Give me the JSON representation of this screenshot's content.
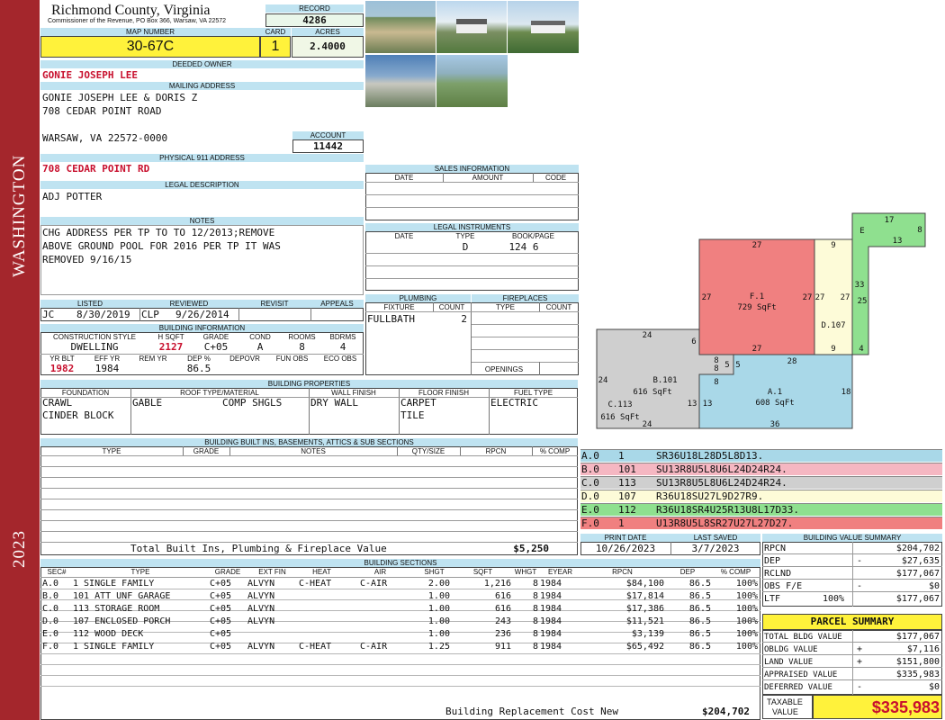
{
  "sidebar": {
    "district": "WASHINGTON",
    "year": "2023"
  },
  "header": {
    "county": "Richmond County, Virginia",
    "address": "Commissioner of the Revenue, PO Box 366, Warsaw, VA 22572"
  },
  "record": {
    "label": "RECORD",
    "value": "4286"
  },
  "map": {
    "label": "MAP NUMBER",
    "value": "30-67C"
  },
  "card": {
    "label": "CARD",
    "value": "1"
  },
  "acres": {
    "label": "ACRES",
    "value": "2.4000"
  },
  "deeded_owner": {
    "label": "DEEDED OWNER",
    "value": "GONIE JOSEPH LEE"
  },
  "mailing": {
    "label": "MAILING ADDRESS",
    "line1": "GONIE JOSEPH LEE & DORIS Z",
    "line2": "708 CEDAR POINT ROAD",
    "line3": "WARSAW, VA 22572-0000"
  },
  "account": {
    "label": "ACCOUNT",
    "value": "11442"
  },
  "physical": {
    "label": "PHYSICAL 911 ADDRESS",
    "value": "708 CEDAR POINT RD"
  },
  "legal": {
    "label": "LEGAL DESCRIPTION",
    "value": "ADJ POTTER"
  },
  "notes": {
    "label": "NOTES",
    "line1": "CHG ADDRESS PER TP TO TO 12/2013;REMOVE",
    "line2": "ABOVE GROUND POOL FOR 2016 PER TP IT WAS",
    "line3": "REMOVED 9/16/15"
  },
  "review": {
    "listed_label": "LISTED",
    "reviewed_label": "REVIEWED",
    "revisit_label": "REVISIT",
    "appeals_label": "APPEALS",
    "listed_by": "JC",
    "listed_date": "8/30/2019",
    "reviewed_by": "CLP",
    "reviewed_date": "9/26/2014"
  },
  "building_info": {
    "label": "BUILDING INFORMATION",
    "h_style": "CONSTRUCTION STYLE",
    "h_sqft": "H SQFT",
    "h_grade": "GRADE",
    "h_cond": "COND",
    "h_rooms": "ROOMS",
    "h_bdrms": "BDRMS",
    "style": "DWELLING",
    "sqft": "2127",
    "grade": "C+05",
    "cond": "A",
    "rooms": "8",
    "bdrms": "4",
    "h_yrblt": "YR BLT",
    "h_effyr": "EFF YR",
    "h_remyr": "REM YR",
    "h_dep": "DEP %",
    "h_depovr": "DEPOVR",
    "h_funobs": "FUN OBS",
    "h_ecoobs": "ECO OBS",
    "yrblt": "1982",
    "effyr": "1984",
    "dep": "86.5"
  },
  "sales": {
    "label": "SALES INFORMATION",
    "h_date": "DATE",
    "h_amount": "AMOUNT",
    "h_code": "CODE"
  },
  "instruments": {
    "label": "LEGAL INSTRUMENTS",
    "h_date": "DATE",
    "h_type": "TYPE",
    "h_book": "BOOK/PAGE",
    "type": "D",
    "book": "124 6"
  },
  "plumbing": {
    "label": "PLUMBING",
    "h_fixture": "FIXTURE",
    "h_count": "COUNT",
    "fixture": "FULLBATH",
    "count": "2"
  },
  "fireplaces": {
    "label": "FIREPLACES",
    "h_type": "TYPE",
    "h_count": "COUNT",
    "openings": "OPENINGS"
  },
  "properties": {
    "label": "BUILDING PROPERTIES",
    "h_foundation": "FOUNDATION",
    "h_roof": "ROOF TYPE/MATERIAL",
    "h_wall": "WALL FINISH",
    "h_floor": "FLOOR FINISH",
    "h_fuel": "FUEL TYPE",
    "foundation1": "CRAWL",
    "foundation2": "CINDER BLOCK",
    "roof_type": "GABLE",
    "roof_mat": "COMP SHGLS",
    "wall": "DRY WALL",
    "floor1": "CARPET",
    "floor2": "TILE",
    "fuel": "ELECTRIC"
  },
  "builtins": {
    "label": "BUILDING BUILT INS, BASEMENTS, ATTICS & SUB SECTIONS",
    "h_type": "TYPE",
    "h_grade": "GRADE",
    "h_notes": "NOTES",
    "h_qty": "QTY/SIZE",
    "h_rpcn": "RPCN",
    "h_comp": "% COMP",
    "total_label": "Total Built Ins, Plumbing & Fireplace Value",
    "total_value": "$5,250"
  },
  "dates": {
    "print_label": "PRINT DATE",
    "print_value": "10/26/2023",
    "saved_label": "LAST SAVED",
    "saved_value": "3/7/2023"
  },
  "sections": {
    "label": "BUILDING SECTIONS",
    "headers": [
      "SEC#",
      "TYPE",
      "GRADE",
      "EXT FIN",
      "HEAT",
      "AIR",
      "SHGT",
      "SQFT",
      "WHGT",
      "EYEAR",
      "RPCN",
      "DEP",
      "% COMP"
    ],
    "rows": [
      [
        "A.0",
        "1 SINGLE FAMILY",
        "C+05",
        "ALVYN",
        "C-HEAT",
        "C-AIR",
        "2.00",
        "1,216",
        "8",
        "1984",
        "$84,100",
        "86.5",
        "100%"
      ],
      [
        "B.0",
        "101 ATT UNF GARAGE",
        "C+05",
        "ALVYN",
        "",
        "",
        "1.00",
        "616",
        "8",
        "1984",
        "$17,814",
        "86.5",
        "100%"
      ],
      [
        "C.0",
        "113 STORAGE ROOM",
        "C+05",
        "ALVYN",
        "",
        "",
        "1.00",
        "616",
        "8",
        "1984",
        "$17,386",
        "86.5",
        "100%"
      ],
      [
        "D.0",
        "107 ENCLOSED PORCH",
        "C+05",
        "ALVYN",
        "",
        "",
        "1.00",
        "243",
        "8",
        "1984",
        "$11,521",
        "86.5",
        "100%"
      ],
      [
        "E.0",
        "112 WOOD DECK",
        "C+05",
        "",
        "",
        "",
        "1.00",
        "236",
        "8",
        "1984",
        "$3,139",
        "86.5",
        "100%"
      ],
      [
        "F.0",
        "1 SINGLE FAMILY",
        "C+05",
        "ALVYN",
        "C-HEAT",
        "C-AIR",
        "1.25",
        "911",
        "8",
        "1984",
        "$65,492",
        "86.5",
        "100%"
      ]
    ],
    "replacement_label": "Building Replacement Cost New",
    "replacement_value": "$204,702"
  },
  "sketch_codes": [
    {
      "code": "A.0",
      "num": "1",
      "vector": "SR36U18L28D5L8D13.",
      "color": "#a9d8e8"
    },
    {
      "code": "B.0",
      "num": "101",
      "vector": "SU13R8U5L8U6L24D24R24.",
      "color": "#f5b7c2"
    },
    {
      "code": "C.0",
      "num": "113",
      "vector": "SU13R8U5L8U6L24D24R24.",
      "color": "#cfcfcf"
    },
    {
      "code": "D.0",
      "num": "107",
      "vector": "R36U18SU27L9D27R9.",
      "color": "#fdfbd8"
    },
    {
      "code": "E.0",
      "num": "112",
      "vector": "R36U18SR4U25R13U8L17D33.",
      "color": "#8fe08f"
    },
    {
      "code": "F.0",
      "num": "1",
      "vector": "U13R8U5L8SR27U27L27D27.",
      "color": "#f08080"
    }
  ],
  "sketch": {
    "f_name": "F.1",
    "f_area": "729 SqFt",
    "d_name": "D.107",
    "b_name": "B.101",
    "b_area": "616 SqFt",
    "c_name": "C.113",
    "c_area": "616 SqFt",
    "a_name": "A.1",
    "a_area": "608 SqFt",
    "e_name": "E",
    "dims": {
      "f_top": "27",
      "f_left": "27",
      "f_right": "27",
      "f_bottom": "27",
      "d_top": "9",
      "d_right": "27",
      "d_bottom": "9",
      "e_top": "17",
      "e_right": "8",
      "e_inner": "13",
      "e_left": "33",
      "e_side": "25",
      "e_bottom": "4",
      "b_top": "24",
      "b_right": "6",
      "b_left": "24",
      "b_8a": "8",
      "b_8b": "8",
      "b_5a": "5",
      "b_5b": "5",
      "b_8c": "8",
      "a_top": "28",
      "a_right": "18",
      "a_bottom": "36",
      "bc_13a": "13",
      "bc_13b": "13",
      "c_bottom": "24"
    }
  },
  "value_summary": {
    "label": "BUILDING VALUE SUMMARY",
    "rpcn_label": "RPCN",
    "rpcn": "$204,702",
    "dep_label": "DEP",
    "dep_sign": "-",
    "dep": "$27,635",
    "rclnd_label": "RCLND",
    "rclnd": "$177,067",
    "obs_label": "OBS F/E",
    "obs_sign": "-",
    "obs": "$0",
    "ltf_label": "LTF",
    "ltf_pct": "100%",
    "ltf": "$177,067"
  },
  "parcel": {
    "title": "PARCEL SUMMARY",
    "bldg_label": "TOTAL BLDG VALUE",
    "bldg": "$177,067",
    "obldg_label": "OBLDG VALUE",
    "obldg_sign": "+",
    "obldg": "$7,116",
    "land_label": "LAND VALUE",
    "land_sign": "+",
    "land": "$151,800",
    "appraised_label": "APPRAISED VALUE",
    "appraised": "$335,983",
    "deferred_label": "DEFERRED VALUE",
    "deferred_sign": "-",
    "deferred": "$0",
    "taxable_label1": "TAXABLE",
    "taxable_label2": "VALUE",
    "taxable": "$335,983"
  }
}
